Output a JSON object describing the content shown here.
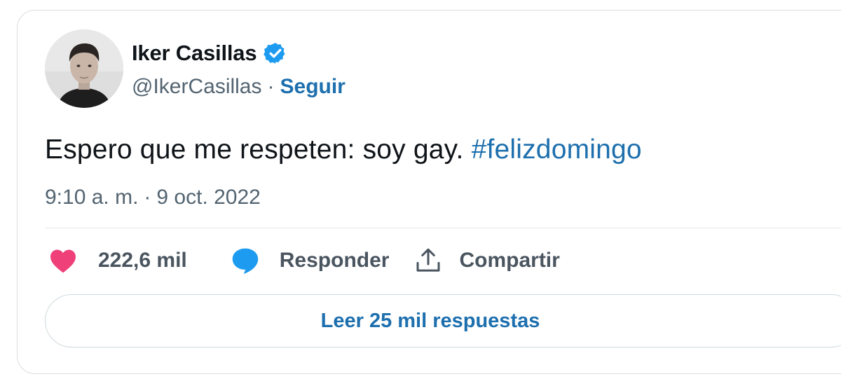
{
  "author": {
    "name": "Iker Casillas",
    "handle": "@IkerCasillas",
    "verified": true,
    "follow_label": "Seguir",
    "separator": "·"
  },
  "tweet": {
    "text": "Espero que me respeten: soy gay.",
    "hashtag": "#felizdomingo",
    "time": "9:10 a. m.",
    "separator": "·",
    "date": "9 oct. 2022"
  },
  "actions": {
    "likes_label": "222,6 mil",
    "reply_label": "Responder",
    "share_label": "Compartir"
  },
  "replies_button": {
    "label": "Leer 25 mil respuestas"
  },
  "colors": {
    "link": "#1d6fae",
    "like": "#f0407a",
    "reply": "#1d9bf0",
    "verified": "#1d9bf0",
    "muted": "#536471"
  }
}
